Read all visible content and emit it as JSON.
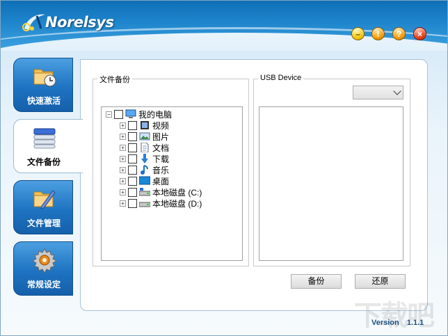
{
  "app": {
    "logo_text": "Norelsys",
    "version_label": "Version",
    "version_number": "1.1.1",
    "watermark": "下载吧"
  },
  "window_buttons": {
    "minimize": "–",
    "alert": "!",
    "help": "?",
    "close": "×"
  },
  "sidebar": {
    "items": [
      {
        "label": "快速激活",
        "icon": "folder-clock-icon",
        "active": false
      },
      {
        "label": "文件备份",
        "icon": "disk-stack-icon",
        "active": true
      },
      {
        "label": "文件管理",
        "icon": "folder-pen-icon",
        "active": false
      },
      {
        "label": "常规设定",
        "icon": "gear-icon",
        "active": false
      }
    ]
  },
  "backup_panel": {
    "title": "文件备份",
    "tree": {
      "root": {
        "label": "我的电脑",
        "expander": "−",
        "icon": "computer-icon"
      },
      "children": [
        {
          "label": "视频",
          "expander": "+",
          "icon": "video-icon"
        },
        {
          "label": "图片",
          "expander": "+",
          "icon": "picture-icon"
        },
        {
          "label": "文档",
          "expander": "+",
          "icon": "document-icon"
        },
        {
          "label": "下载",
          "expander": "+",
          "icon": "download-icon"
        },
        {
          "label": "音乐",
          "expander": "+",
          "icon": "music-icon"
        },
        {
          "label": "桌面",
          "expander": "+",
          "icon": "desktop-icon"
        },
        {
          "label": "本地磁盘 (C:)",
          "expander": "+",
          "icon": "drive-icon"
        },
        {
          "label": "本地磁盘 (D:)",
          "expander": "+",
          "icon": "drive-icon"
        }
      ]
    }
  },
  "usb_panel": {
    "title": "USB Device",
    "selected_device": ""
  },
  "actions": {
    "backup_label": "备份",
    "restore_label": "还原"
  }
}
